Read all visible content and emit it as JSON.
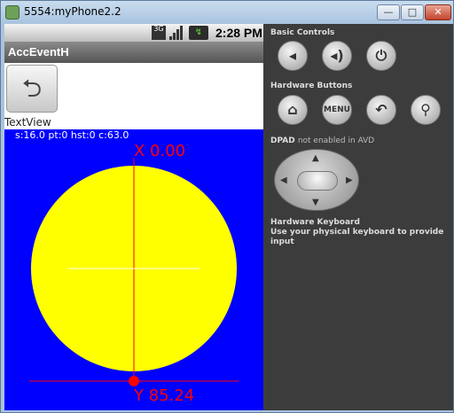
{
  "window": {
    "title": "5554:myPhone2.2",
    "min_label": "—",
    "max_label": "□",
    "close_label": "✕"
  },
  "statusbar": {
    "network": "3G",
    "battery": "↯",
    "time": "2:28 PM"
  },
  "app": {
    "title": "AccEventH",
    "back_glyph": "⮌",
    "textview": "TextView"
  },
  "canvas": {
    "stats": "s:16.0 pt:0 hst:0 c:63.0",
    "x_label": "X  0.00",
    "y_label": "Y  85.24"
  },
  "controls": {
    "basic_title": "Basic Controls",
    "basic": [
      "volume-down-icon",
      "volume-up-icon",
      "power-icon"
    ],
    "hardware_title": "Hardware Buttons",
    "hardware": [
      "home-icon",
      "menu",
      "back-icon",
      "search-icon"
    ],
    "menu_label": "MENU",
    "dpad_title": "DPAD",
    "dpad_note": "not enabled in AVD",
    "keyboard_title": "Hardware Keyboard",
    "keyboard_note": "Use your physical keyboard to provide input"
  },
  "colors": {
    "canvas_bg": "#0000ff",
    "circle": "#ffff00",
    "accent": "#ff0000"
  }
}
